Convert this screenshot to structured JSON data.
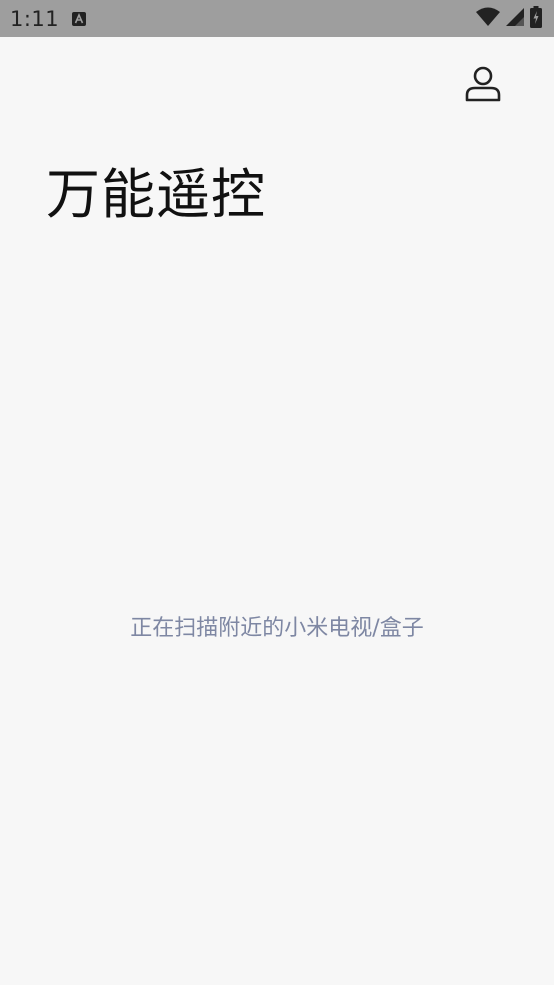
{
  "status_bar": {
    "time": "1:11",
    "notification_icon": "text-a-icon",
    "wifi_icon": "wifi-icon",
    "signal_icon": "cell-signal-icon",
    "battery_icon": "battery-charging-icon",
    "background_color": "#9e9e9e"
  },
  "header": {
    "profile_icon": "user-profile-icon"
  },
  "main": {
    "title": "万能遥控",
    "scan_status": "正在扫描附近的小米电视/盒子",
    "scan_status_color": "#7e87a3",
    "background_color": "#f7f7f7"
  }
}
